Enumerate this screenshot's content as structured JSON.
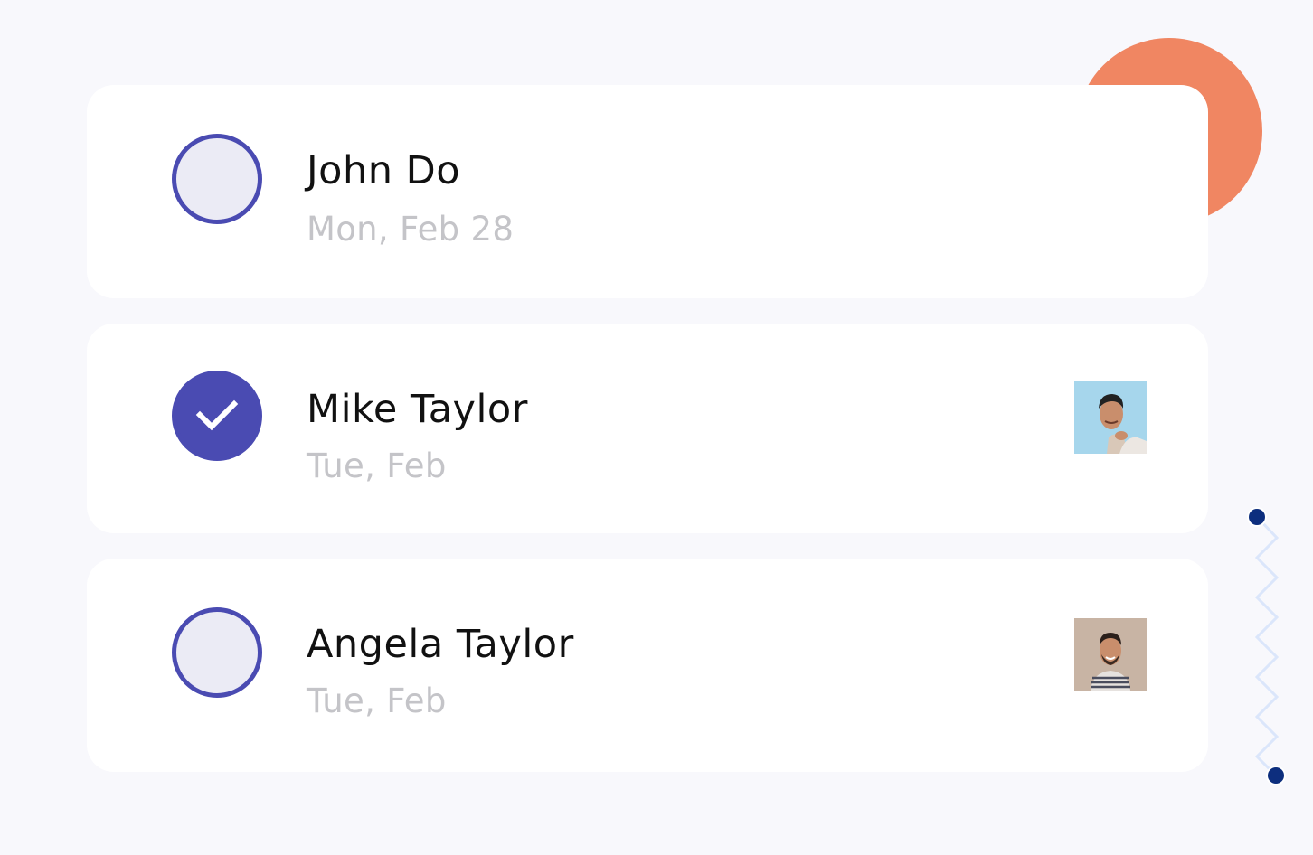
{
  "tasks": [
    {
      "name": "John Do",
      "date": "Mon, Feb 28",
      "checked": false,
      "avatar": null
    },
    {
      "name": "Mike Taylor",
      "date": "Tue, Feb",
      "checked": true,
      "avatar": "man-portrait-blue-background"
    },
    {
      "name": "Angela Taylor",
      "date": "Tue, Feb",
      "checked": false,
      "avatar": "man-portrait-beige-background"
    }
  ],
  "colors": {
    "background": "#f8f8fc",
    "card": "#ffffff",
    "accent": "#4a4bb2",
    "unchecked_fill": "#ebebf5",
    "date_text": "#c4c4c8",
    "deco_orange": "#f08662",
    "deco_navy": "#0d2e7e"
  },
  "icons": {
    "checked": "check-icon",
    "unchecked": "empty-circle"
  }
}
